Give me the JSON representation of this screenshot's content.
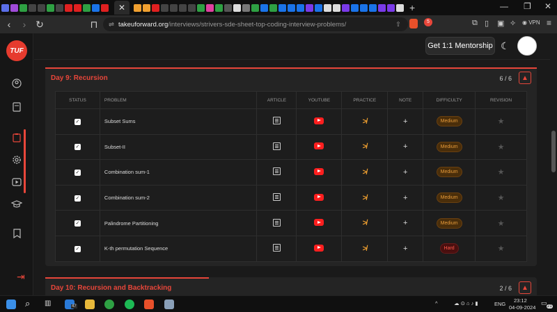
{
  "browser": {
    "url_host": "takeuforward.org",
    "url_path": "/interviews/strivers-sde-sheet-top-coding-interview-problems/",
    "new_tab": "+",
    "vpn_label": "VPN",
    "brave_badge": "5"
  },
  "header": {
    "mentorship_label": "Get 1:1 Mentorship"
  },
  "logo_text": "TUF",
  "sections": [
    {
      "title": "Day 9: Recursion",
      "count": "6 / 6",
      "progress": 1.0,
      "columns": [
        "Status",
        "Problem",
        "Article",
        "YouTube",
        "Practice",
        "Note",
        "Difficulty",
        "Revision"
      ],
      "rows": [
        {
          "problem": "Subset Sums",
          "difficulty": "Medium"
        },
        {
          "problem": "Subset-II",
          "difficulty": "Medium"
        },
        {
          "problem": "Combination sum-1",
          "difficulty": "Medium"
        },
        {
          "problem": "Combination sum-2",
          "difficulty": "Medium"
        },
        {
          "problem": "Palindrome Partitioning",
          "difficulty": "Medium"
        },
        {
          "problem": "K-th permutation Sequence",
          "difficulty": "Hard"
        }
      ]
    },
    {
      "title": "Day 10: Recursion and Backtracking",
      "count": "2 / 6",
      "progress": 0.333
    }
  ],
  "taskbar": {
    "mail_badge": "47",
    "lang": "ENG",
    "time": "23:12",
    "date": "04-09-2024",
    "notif_count": "21"
  },
  "colors": {
    "accent": "#e8463a",
    "medium": "#e59a3a",
    "hard": "#ff5a4a",
    "youtube": "#ff1f1f"
  }
}
